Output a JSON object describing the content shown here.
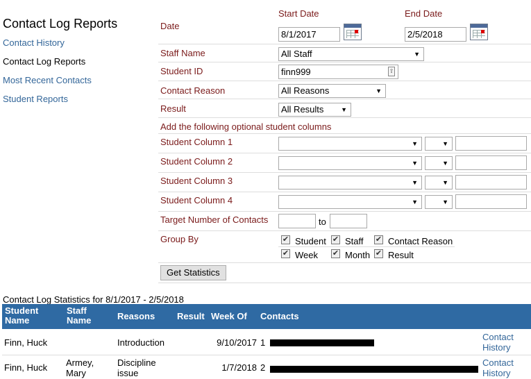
{
  "sidebar": {
    "title": "Contact Log Reports",
    "items": [
      {
        "label": "Contact History"
      },
      {
        "label": "Contact Log Reports"
      },
      {
        "label": "Most Recent Contacts"
      },
      {
        "label": "Student Reports"
      }
    ]
  },
  "form": {
    "date": {
      "label": "Date",
      "start_header": "Start Date",
      "end_header": "End Date",
      "start_value": "8/1/2017",
      "end_value": "2/5/2018"
    },
    "staff_name": {
      "label": "Staff Name",
      "value": "All Staff"
    },
    "student_id": {
      "label": "Student ID",
      "value": "finn999"
    },
    "contact_reason": {
      "label": "Contact Reason",
      "value": "All Reasons"
    },
    "result": {
      "label": "Result",
      "value": "All Results"
    },
    "optional_header": "Add the following optional student columns",
    "student_columns": [
      {
        "label": "Student Column 1"
      },
      {
        "label": "Student Column 2"
      },
      {
        "label": "Student Column 3"
      },
      {
        "label": "Student Column 4"
      }
    ],
    "target": {
      "label": "Target Number of Contacts",
      "to_label": "to"
    },
    "group_by": {
      "label": "Group By",
      "options": [
        {
          "label": "Student",
          "checked": true
        },
        {
          "label": "Staff",
          "checked": true
        },
        {
          "label": "Contact Reason",
          "checked": true
        },
        {
          "label": "Week",
          "checked": true
        },
        {
          "label": "Month",
          "checked": true
        },
        {
          "label": "Result",
          "checked": true
        }
      ]
    },
    "submit_label": "Get Statistics"
  },
  "stats": {
    "title": "Contact Log Statistics for 8/1/2017 - 2/5/2018",
    "columns": [
      "Student Name",
      "Staff Name",
      "Reasons",
      "Result",
      "Week Of",
      "Contacts"
    ],
    "rows": [
      {
        "student": "Finn, Huck",
        "staff": "",
        "reason": "Introduction",
        "result": "",
        "week_of": "9/10/2017",
        "contacts": "1",
        "link": "Contact History"
      },
      {
        "student": "Finn, Huck",
        "staff": "Armey, Mary",
        "reason": "Discipline issue",
        "result": "",
        "week_of": "1/7/2018",
        "contacts": "2",
        "link": "Contact History"
      }
    ]
  },
  "colors": {
    "label": "#7a1a1a",
    "link": "#336699",
    "table_header": "#2f6aa3"
  }
}
